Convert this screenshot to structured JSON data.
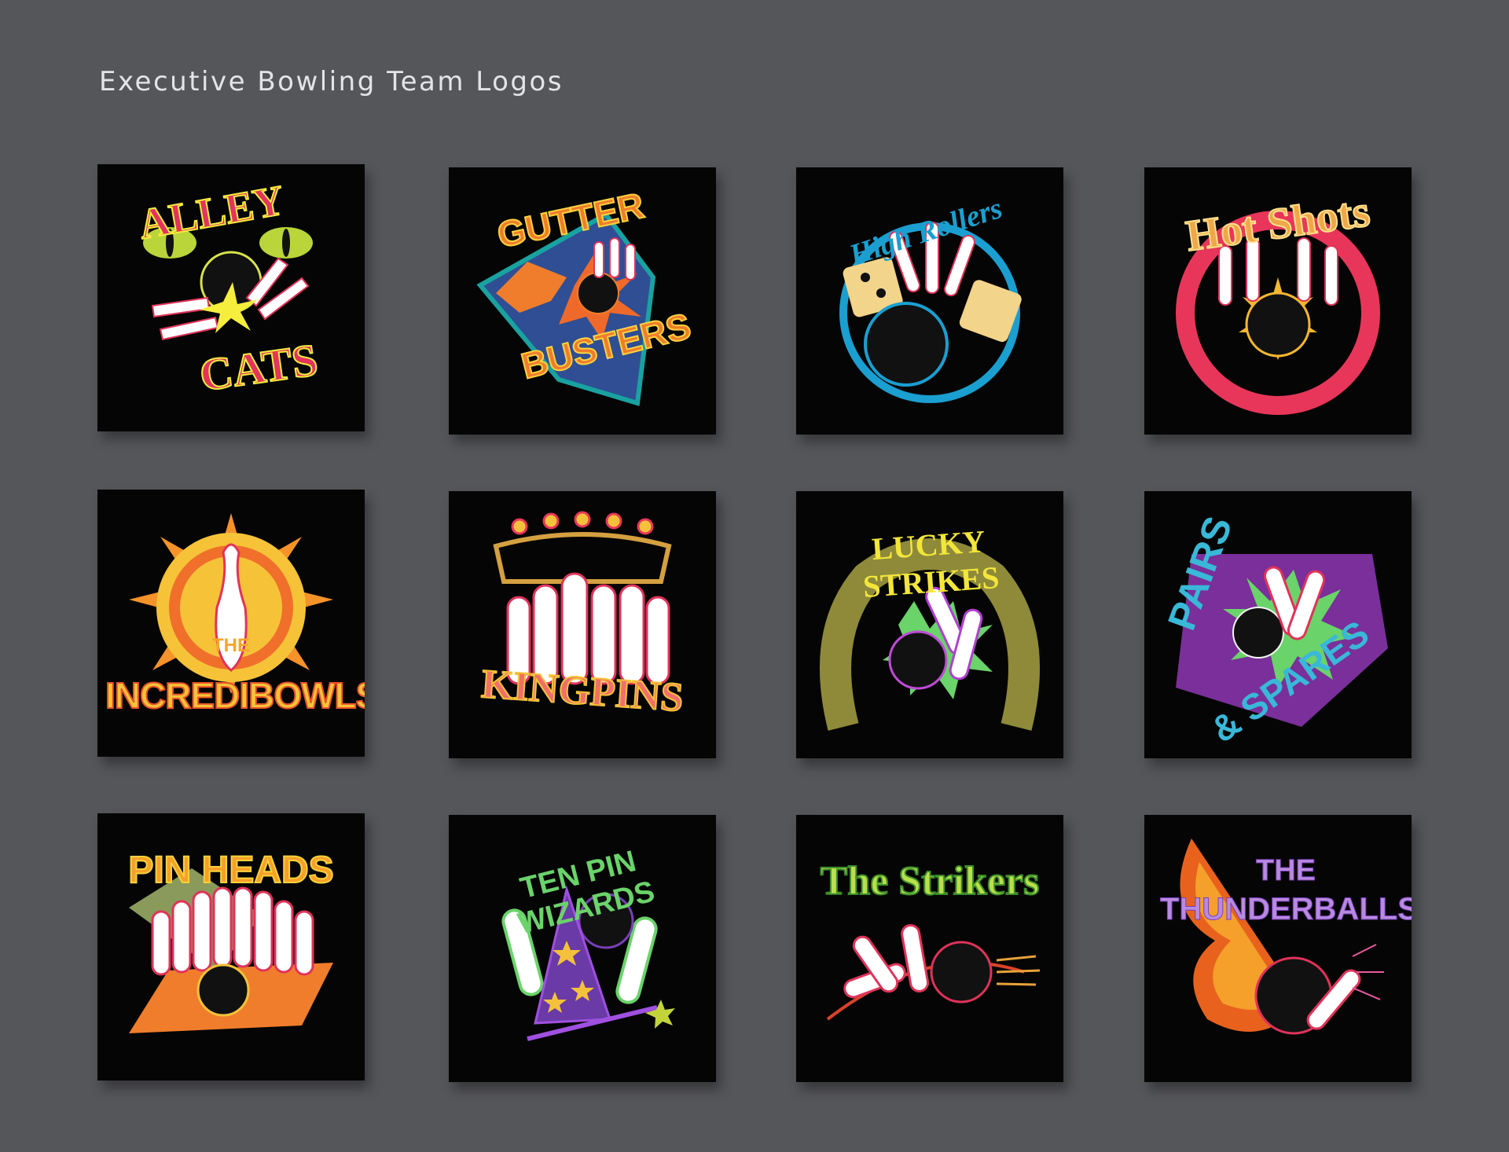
{
  "page": {
    "title": "Executive Bowling Team Logos"
  },
  "colors": {
    "background": "#55565a",
    "tile": "#050505",
    "heading": "#e4e4e6"
  },
  "logos": [
    {
      "lines": [
        "ALLEY",
        "CATS"
      ]
    },
    {
      "lines": [
        "GUTTER",
        "BUSTERS"
      ]
    },
    {
      "lines": [
        "High Rollers"
      ]
    },
    {
      "lines": [
        "Hot Shots"
      ]
    },
    {
      "lines": [
        "THE",
        "INCREDIBOWLS"
      ]
    },
    {
      "lines": [
        "KINGPINS"
      ]
    },
    {
      "lines": [
        "LUCKY STRIKES"
      ]
    },
    {
      "lines": [
        "PAIRS",
        "& SPARES"
      ]
    },
    {
      "lines": [
        "PIN HEADS"
      ]
    },
    {
      "lines": [
        "TEN PIN WIZARDS"
      ]
    },
    {
      "lines": [
        "The Strikers"
      ]
    },
    {
      "lines": [
        "THE",
        "THUNDERBALLS"
      ]
    }
  ]
}
